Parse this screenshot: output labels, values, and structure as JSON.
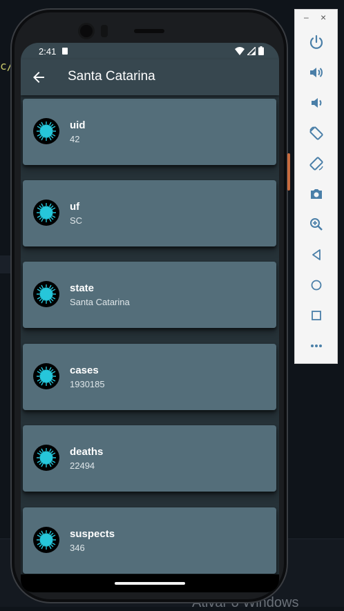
{
  "desktop": {
    "code_fragment": "c/",
    "watermark": "Ativar o Windows"
  },
  "status_bar": {
    "time": "2:41"
  },
  "app_bar": {
    "title": "Santa Catarina"
  },
  "items": [
    {
      "title": "uid",
      "value": "42"
    },
    {
      "title": "uf",
      "value": "SC"
    },
    {
      "title": "state",
      "value": "Santa Catarina"
    },
    {
      "title": "cases",
      "value": "1930185"
    },
    {
      "title": "deaths",
      "value": "22494"
    },
    {
      "title": "suspects",
      "value": "346"
    }
  ],
  "emulator_toolbar": {
    "minimize": "–",
    "close": "×",
    "buttons": [
      "power-icon",
      "volume-up-icon",
      "volume-down-icon",
      "rotate-left-icon",
      "rotate-right-icon",
      "camera-icon",
      "zoom-icon",
      "back-icon",
      "home-icon",
      "overview-icon",
      "more-icon"
    ]
  },
  "colors": {
    "app_bar": "#37474f",
    "background": "#263238",
    "card": "#546e7a",
    "virus": "#26c6da"
  }
}
